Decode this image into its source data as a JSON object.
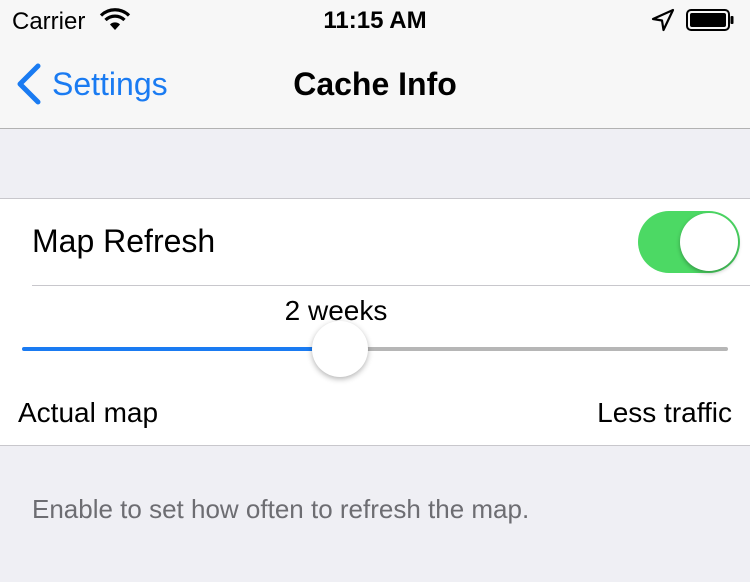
{
  "status_bar": {
    "carrier": "Carrier",
    "time": "11:15 AM",
    "icons": [
      "wifi-icon",
      "location-arrow-icon",
      "battery-icon"
    ]
  },
  "nav": {
    "back_label": "Settings",
    "title": "Cache Info"
  },
  "settings": {
    "map_refresh_label": "Map Refresh",
    "map_refresh_enabled": true,
    "slider_value_label": "2 weeks",
    "slider_fraction": 0.45,
    "slider_min_label": "Actual map",
    "slider_max_label": "Less traffic"
  },
  "footer": {
    "text": "Enable to set how often to refresh the map."
  },
  "colors": {
    "accent": "#1A7BF2",
    "toggle_on": "#4CD964",
    "background": "#EFEFF4"
  }
}
